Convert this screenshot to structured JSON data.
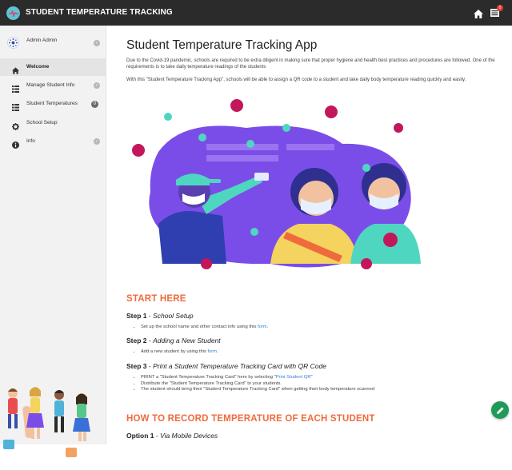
{
  "header": {
    "app_title": "STUDENT TEMPERATURE TRACKING",
    "message_count": "0"
  },
  "sidebar": {
    "user_name": "Admin Admin",
    "items": [
      {
        "label": "Welcome",
        "icon": "home-icon"
      },
      {
        "label": "Manage Student Info",
        "icon": "grid-icon"
      },
      {
        "label": "Student Temperatures",
        "icon": "list-icon",
        "badge": "0"
      },
      {
        "label": "School Setup",
        "icon": "gear-icon"
      },
      {
        "label": "Info",
        "icon": "info-icon"
      }
    ]
  },
  "main": {
    "title": "Student Temperature Tracking App",
    "intro_1": "Due to the Covid-19 pandemic, schools are required to be extra diligent in making sure that proper hygiene and health best practices and procedures are followed. One of the requirements is to take daily temperature readings of the students",
    "intro_2": "With this \"Student Temperature Tracking App\", schools will be able to assign a QR code to a student and take daily body temperature reading quickly and easily.",
    "start_here": "START HERE",
    "step1": {
      "num": "Step 1",
      "title": "School Setup",
      "bullet_pre": "Set up the school name and other contact info using this ",
      "bullet_link": "form",
      "bullet_post": "."
    },
    "step2": {
      "num": "Step 2",
      "title": "Adding a New Student",
      "bullet_pre": "Add a new student by using this ",
      "bullet_link": "form",
      "bullet_post": "."
    },
    "step3": {
      "num": "Step 3",
      "title": "Print a Student Temperature Tracking Card with QR Code",
      "b1_pre": "PRINT a \"Student Temperature Tracking Card\" here by selecting \"",
      "b1_link": "Print Student QR",
      "b1_post": "\"",
      "b2": "Distribute the \"Student Temperature Tracking Card\" to your students.",
      "b3": "The student should bring their \"Student Temperature Tracking Card\" when getting their body temperature scanned"
    },
    "how_to": "HOW TO RECORD TEMPERATURE OF EACH STUDENT",
    "option1": {
      "num": "Option 1",
      "title": "Via Mobile Devices"
    }
  },
  "colors": {
    "topbar": "#2b2b2b",
    "accent": "#ef6b3b",
    "link": "#2f7fd6",
    "fab": "#1f9a59",
    "hero_purple": "#7a4de8"
  }
}
